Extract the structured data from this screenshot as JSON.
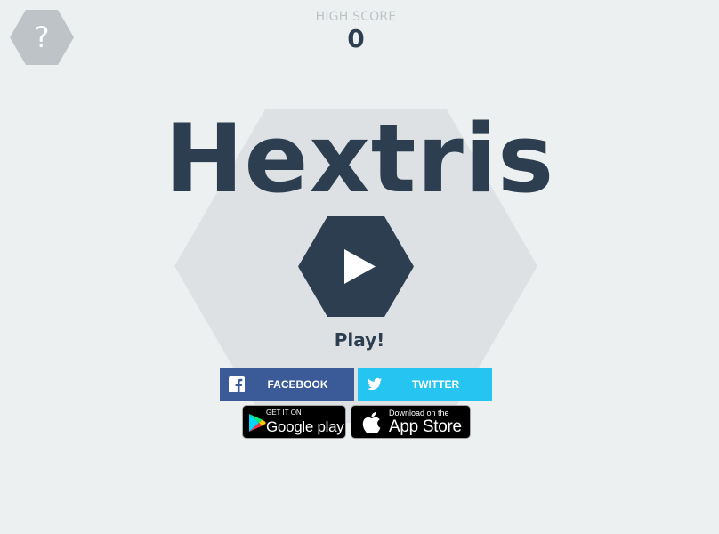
{
  "help_button": {
    "glyph": "?",
    "icon": "question-mark-icon"
  },
  "high_score": {
    "label": "HIGH SCORE",
    "value": "0"
  },
  "title": "Hextris",
  "play": {
    "icon": "play-icon",
    "label": "Play!"
  },
  "share": {
    "facebook_label": "FACEBOOK",
    "twitter_label": "TWITTER",
    "facebook_icon": "facebook-icon",
    "twitter_icon": "twitter-icon"
  },
  "stores": {
    "google": {
      "small": "GET IT ON",
      "big": "Google play",
      "icon": "google-play-icon"
    },
    "apple": {
      "small": "Download on the",
      "big": "App Store",
      "icon": "apple-icon"
    }
  },
  "colors": {
    "background": "#ecf0f1",
    "hex_light": "#dde1e4",
    "hex_help": "#bdc3c7",
    "dark": "#2c3e50",
    "facebook": "#3a5a98",
    "twitter": "#26c4f0"
  }
}
